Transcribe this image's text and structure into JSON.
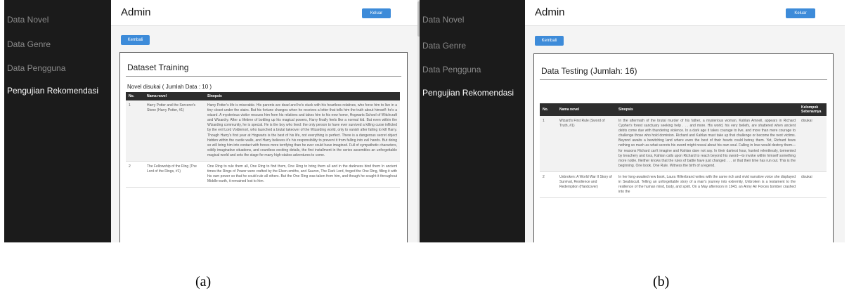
{
  "panel_a": {
    "sidebar": {
      "items": [
        {
          "label": "Data Novel"
        },
        {
          "label": "Data Genre"
        },
        {
          "label": "Data Pengguna"
        },
        {
          "label": "Pengujian Rekomendasi"
        }
      ]
    },
    "header": {
      "title": "Admin",
      "logout_label": "Keluar"
    },
    "back_label": "Kembali",
    "card": {
      "title": "Dataset Training",
      "subtitle": "Novel disukai ( Jumlah Data : 10 )",
      "columns": [
        "No.",
        "Nama novel",
        "Sinopsis"
      ],
      "rows": [
        {
          "no": "1",
          "name": "Harry Potter and the Sorcerer's Stone (Harry Potter, #1)",
          "synopsis": "Harry Potter's life is miserable. His parents are dead and he's stuck with his heartless relatives, who force him to live in a tiny closet under the stairs. But his fortune changes when he receives a letter that tells him the truth about himself: he's a wizard. A mysterious visitor rescues him from his relatives and takes him to his new home, Hogwarts School of Witchcraft and Wizardry. After a lifetime of bottling up his magical powers, Harry finally feels like a normal kid. But even within the Wizarding community, he is special. He is the boy who lived: the only person to have ever survived a killing curse inflicted by the evil Lord Voldemort, who launched a brutal takeover of the Wizarding world, only to vanish after failing to kill Harry. Though Harry's first year at Hogwarts is the best of his life, not everything is perfect. There is a dangerous secret object hidden within the castle walls, and Harry believes it's his responsibility to prevent it from falling into evil hands. But doing so will bring him into contact with forces more terrifying than he ever could have imagined. Full of sympathetic characters, wildly imaginative situations, and countless exciting details, the first installment in the series assembles an unforgettable magical world and sets the stage for many high-stakes adventures to come."
        },
        {
          "no": "2",
          "name": "The Fellowship of the Ring (The Lord of the Rings, #1)",
          "synopsis": "One Ring to rule them all, One Ring to find them, One Ring to bring them all and in the darkness bind them In ancient times the Rings of Power were crafted by the Elven-smiths, and Sauron, The Dark Lord, forged the One Ring, filling it with his own power so that he could rule all others. But the One Ring was taken from him, and though he sought it throughout Middle-earth, it remained lost to him."
        }
      ]
    }
  },
  "panel_b": {
    "sidebar": {
      "items": [
        {
          "label": "Data Novel"
        },
        {
          "label": "Data Genre"
        },
        {
          "label": "Data Pengguna"
        },
        {
          "label": "Pengujian Rekomendasi"
        }
      ]
    },
    "header": {
      "title": "Admin",
      "logout_label": "Keluar"
    },
    "back_label": "Kembali",
    "card": {
      "title": "Data Testing (Jumlah: 16)",
      "columns": [
        "No.",
        "Nama novel",
        "Sinopsis",
        "Kelompok Sebenarnya"
      ],
      "rows": [
        {
          "no": "1",
          "name": "Wizard's First Rule (Sword of Truth, #1)",
          "synopsis": "In the aftermath of the brutal murder of his father, a mysterious woman, Kahlan Amnell, appears in Richard Cypher's forest sanctuary seeking help . . . and more. His world, his very beliefs, are shattered when ancient debts come due with thundering violence. In a dark age it takes courage to live, and more than mere courage to challenge those who hold dominion. Richard and Kahlan must take up that challenge or become the next victims. Beyond awaits a bewitching land where even the best of their hearts could betray them. Yet, Richard fears nothing so much as what secrets his sword might reveal about his own soul. Falling in love would destroy them—for reasons Richard can't imagine and Kahlan dare not say. In their darkest hour, hunted relentlessly, tormented by treachery and loss, Kahlan calls upon Richard to reach beyond his sword—to invoke within himself something more noble. Neither knows that the rules of battle have just changed . . . or that their time has run out. This is the beginning. One book. One Rule. Witness the birth of a legend.",
          "group": "disukai"
        },
        {
          "no": "2",
          "name": "Unbroken: A World War II Story of Survival, Resilience and Redemption (Hardcover)",
          "synopsis": "In her long-awaited new book, Laura Hillenbrand writes with the same rich and vivid narrative voice she displayed in Seabiscuit. Telling an unforgettable story of a man's journey into extremity, Unbroken is a testament to the resilience of the human mind, body, and spirit. On a May afternoon in 1943, an Army Air Forces bomber crashed into the",
          "group": "disukai"
        }
      ]
    }
  },
  "captions": {
    "a": "(a)",
    "b": "(b)"
  }
}
